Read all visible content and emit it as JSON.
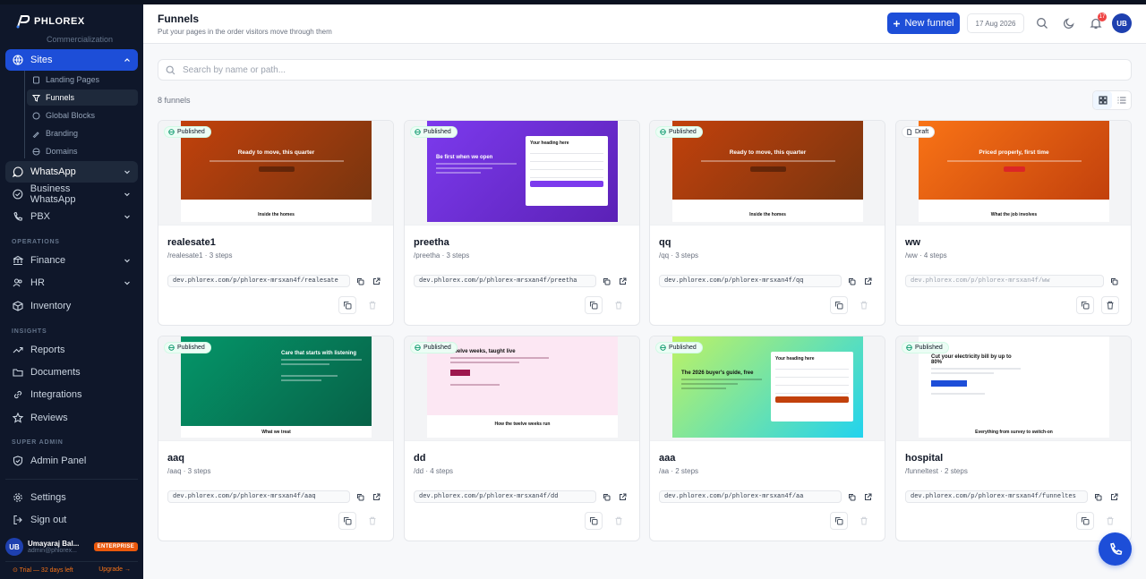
{
  "brand": {
    "logo_text": "PHLOREX"
  },
  "sidebar": {
    "clipped_item": "Commercialization",
    "sites_label": "Sites",
    "sites_children": [
      "Landing Pages",
      "Funnels",
      "Global Blocks",
      "Branding",
      "Domains"
    ],
    "whatsapp_label": "WhatsApp",
    "business_whatsapp_label": "Business WhatsApp",
    "pbx_label": "PBX",
    "operations_title": "OPERATIONS",
    "operations": [
      "Finance",
      "HR",
      "Inventory"
    ],
    "insights_title": "INSIGHTS",
    "insights": [
      "Reports",
      "Documents",
      "Integrations",
      "Reviews"
    ],
    "super_admin_title": "SUPER ADMIN",
    "admin_panel_label": "Admin Panel",
    "settings_label": "Settings",
    "signout_label": "Sign out",
    "user": {
      "initials": "UB",
      "name": "Umayaraj Bal...",
      "email": "admin@phlorex...",
      "plan_badge": "ENTERPRISE"
    },
    "trial_text": "⊙ Trial — 32 days left",
    "upgrade_label": "Upgrade →"
  },
  "header": {
    "title": "Funnels",
    "subtitle": "Put your pages in the order visitors move through them",
    "new_button": "New funnel",
    "date": "17 Aug 2026",
    "notif_count": "17",
    "avatar_initials": "UB"
  },
  "search": {
    "placeholder": "Search by name or path..."
  },
  "count_label": "8 funnels",
  "cards": [
    {
      "name": "realesate1",
      "meta": "/realesate1 · 3 steps",
      "url": "dev.phlorex.com/p/phlorex-mrsxan4f/realesate",
      "status": "Published",
      "preview": {
        "headline": "Ready to move, this quarter",
        "below": "Inside the homes",
        "color": "#b45309"
      }
    },
    {
      "name": "preetha",
      "meta": "/preetha · 3 steps",
      "url": "dev.phlorex.com/p/phlorex-mrsxan4f/preetha",
      "status": "Published",
      "preview": {
        "headline": "Be first when we open",
        "form_title": "Your heading here",
        "color": "#6d28d9"
      }
    },
    {
      "name": "qq",
      "meta": "/qq · 3 steps",
      "url": "dev.phlorex.com/p/phlorex-mrsxan4f/qq",
      "status": "Published",
      "preview": {
        "headline": "Ready to move, this quarter",
        "below": "Inside the homes",
        "color": "#b45309"
      }
    },
    {
      "name": "ww",
      "meta": "/ww · 4 steps",
      "url": "dev.phlorex.com/p/phlorex-mrsxan4f/ww",
      "status": "Draft",
      "preview": {
        "headline": "Priced properly, first time",
        "below": "What the job involves",
        "color": "#ea580c"
      }
    },
    {
      "name": "aaq",
      "meta": "/aaq · 3 steps",
      "url": "dev.phlorex.com/p/phlorex-mrsxan4f/aaq",
      "status": "Published",
      "preview": {
        "headline": "Care that starts with listening",
        "below": "What we treat",
        "color": "#047857"
      }
    },
    {
      "name": "dd",
      "meta": "/dd · 4 steps",
      "url": "dev.phlorex.com/p/phlorex-mrsxan4f/dd",
      "status": "Published",
      "preview": {
        "headline": "Twelve weeks, taught live",
        "below": "How the twelve weeks run",
        "color": "#fce7f3"
      }
    },
    {
      "name": "aaa",
      "meta": "/aa · 2 steps",
      "url": "dev.phlorex.com/p/phlorex-mrsxan4f/aa",
      "status": "Published",
      "preview": {
        "headline": "The 2026 buyer's guide, free",
        "form_title": "Your heading here",
        "color": "#a3e635"
      }
    },
    {
      "name": "hospital",
      "meta": "/funneltest · 2 steps",
      "url": "dev.phlorex.com/p/phlorex-mrsxan4f/funneltes",
      "status": "Published",
      "preview": {
        "headline": "Cut your electricity bill by up to 80%",
        "below": "Everything from survey to switch-on",
        "color": "#ffffff"
      }
    }
  ]
}
